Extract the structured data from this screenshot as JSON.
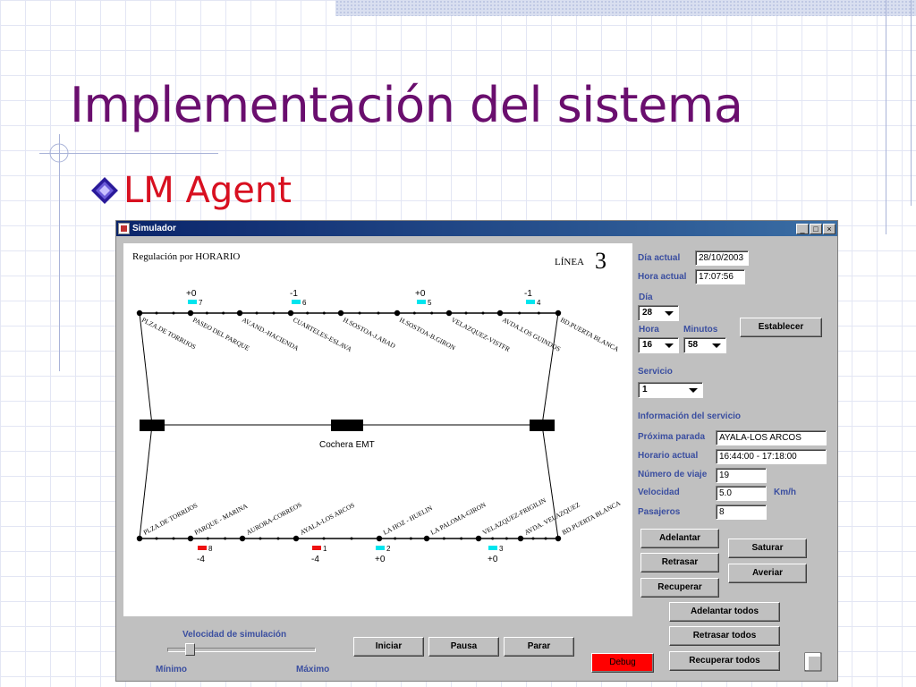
{
  "slide": {
    "title": "Implementación del sistema",
    "bullet": "LM Agent"
  },
  "window": {
    "title": "Simulador",
    "controls": [
      "_",
      "□",
      "×"
    ]
  },
  "canvas": {
    "header_left": "Regulación por HORARIO",
    "line_label": "LÍNEA",
    "line_number": "3",
    "depot_label": "Cochera EMT",
    "top_stops": [
      "PLZA.DE TORRIJOS",
      "PASEO DEL PARQUE",
      "AV.AND.-HACIENDA",
      "CUARTELES-ESLAVA",
      "H.SOSTOA-J.ABAD",
      "H.SOSTOA-B.GIRON",
      "VELAZQUEZ-VISTFR",
      "AVDA.LOS GUINDOS",
      "BD.PUERTA BLANCA"
    ],
    "bottom_stops": [
      "PLZA.DE TORRIJOS",
      "PARQUE - MARINA",
      "AURORA-CORREOS",
      "AYALA-LOS ARCOS",
      "LA HOZ - HUELIN",
      "LA PALOMA-GIRON",
      "VELAZQUEZ-FRIGILIN",
      "AVDA. VELAZQUEZ",
      "BD.PUERTA BLANCA"
    ],
    "top_buses": [
      {
        "deviation": "+0",
        "id": "7",
        "color": "#00e5ee"
      },
      {
        "deviation": "-1",
        "id": "6",
        "color": "#00e5ee"
      },
      {
        "deviation": "+0",
        "id": "5",
        "color": "#00e5ee"
      },
      {
        "deviation": "-1",
        "id": "4",
        "color": "#00e5ee"
      }
    ],
    "bottom_buses": [
      {
        "deviation": "-4",
        "id": "8",
        "color": "#ee1111"
      },
      {
        "deviation": "-4",
        "id": "1",
        "color": "#ee1111"
      },
      {
        "deviation": "+0",
        "id": "2",
        "color": "#00e5ee"
      },
      {
        "deviation": "+0",
        "id": "3",
        "color": "#00e5ee"
      }
    ]
  },
  "panel": {
    "dia_actual_label": "Día actual",
    "dia_actual_value": "28/10/2003",
    "hora_actual_label": "Hora actual",
    "hora_actual_value": "17:07:56",
    "dia_label": "Día",
    "dia_value": "28",
    "hora_label": "Hora",
    "hora_value": "16",
    "minutos_label": "Minutos",
    "minutos_value": "58",
    "establecer_label": "Establecer",
    "servicio_label": "Servicio",
    "servicio_value": "1",
    "info_label": "Información del servicio",
    "proxima_parada_label": "Próxima parada",
    "proxima_parada_value": "AYALA-LOS ARCOS",
    "horario_actual_label": "Horario actual",
    "horario_actual_value": "16:44:00 - 17:18:00",
    "numero_viaje_label": "Número de viaje",
    "numero_viaje_value": "19",
    "velocidad_label": "Velocidad",
    "velocidad_value": "5.0",
    "velocidad_unit": "Km/h",
    "pasajeros_label": "Pasajeros",
    "pasajeros_value": "8",
    "adelantar_label": "Adelantar",
    "retrasar_label": "Retrasar",
    "recuperar_label": "Recuperar",
    "saturar_label": "Saturar",
    "averiar_label": "Averiar",
    "adelantar_todos_label": "Adelantar todos",
    "retrasar_todos_label": "Retrasar todos",
    "recuperar_todos_label": "Recuperar todos"
  },
  "bottom": {
    "speed_label": "Velocidad de simulación",
    "min_label": "Mínimo",
    "max_label": "Máximo",
    "speed_level": 0.13,
    "iniciar_label": "Iniciar",
    "pausa_label": "Pausa",
    "parar_label": "Parar",
    "debug_label": "Debug"
  }
}
